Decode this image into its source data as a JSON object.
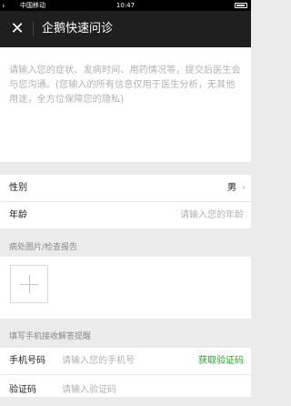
{
  "statusbar": {
    "signal": "ᵢᵢᵢ",
    "carrier": "中国移动",
    "time": "10:47"
  },
  "navbar": {
    "close_glyph": "✕",
    "title": "企鹅快速问诊"
  },
  "description": {
    "placeholder": "请输入您的症状、发病时间、用药情况等，提交后医生会与您沟通。(您输入的所有信息仅用于医生分析，无其他用途，全方位保障您的隐私)"
  },
  "gender": {
    "label": "性别",
    "value": "男",
    "chevron": "›"
  },
  "age": {
    "label": "年龄",
    "placeholder": "请输入您的年龄"
  },
  "photos": {
    "section_title": "病处图片/检查报告"
  },
  "phone_section": {
    "section_title": "填写手机接收解答提醒",
    "phone_label": "手机号码",
    "phone_placeholder": "请输入您的手机号",
    "get_code": "获取验证码",
    "code_label": "验证码",
    "code_placeholder": "请输入验证码"
  },
  "colors": {
    "accent_green": "#1aad19",
    "navbar_bg": "#1f1f1f"
  }
}
